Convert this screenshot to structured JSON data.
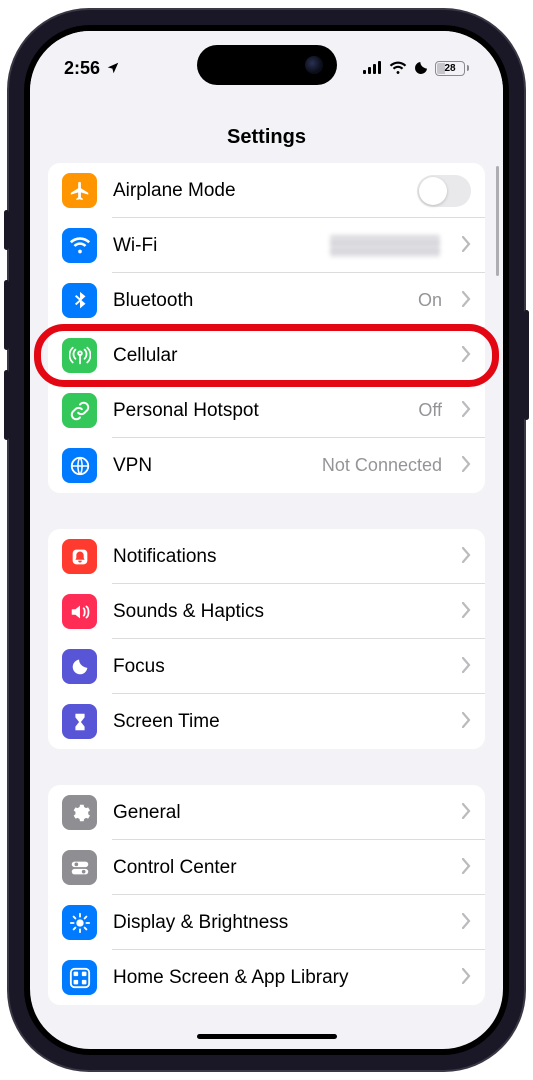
{
  "status": {
    "time": "2:56",
    "battery_percent": "28"
  },
  "header": {
    "title": "Settings"
  },
  "groups": [
    {
      "items": [
        {
          "label": "Airplane Mode",
          "value": "",
          "type": "toggle",
          "toggled": false,
          "icon": "airplane",
          "color": "c-orange"
        },
        {
          "label": "Wi-Fi",
          "value": "",
          "type": "link-redacted",
          "icon": "wifi",
          "color": "c-blue"
        },
        {
          "label": "Bluetooth",
          "value": "On",
          "type": "link",
          "icon": "bluetooth",
          "color": "c-blue"
        },
        {
          "label": "Cellular",
          "value": "",
          "type": "link",
          "icon": "antenna",
          "color": "c-green",
          "highlighted": true
        },
        {
          "label": "Personal Hotspot",
          "value": "Off",
          "type": "link",
          "icon": "link",
          "color": "c-green2"
        },
        {
          "label": "VPN",
          "value": "Not Connected",
          "type": "link",
          "icon": "globe",
          "color": "c-blue"
        }
      ]
    },
    {
      "items": [
        {
          "label": "Notifications",
          "value": "",
          "type": "link",
          "icon": "bell",
          "color": "c-red"
        },
        {
          "label": "Sounds & Haptics",
          "value": "",
          "type": "link",
          "icon": "speaker",
          "color": "c-pink"
        },
        {
          "label": "Focus",
          "value": "",
          "type": "link",
          "icon": "moon",
          "color": "c-indigo"
        },
        {
          "label": "Screen Time",
          "value": "",
          "type": "link",
          "icon": "hourglass",
          "color": "c-indigo"
        }
      ]
    },
    {
      "items": [
        {
          "label": "General",
          "value": "",
          "type": "link",
          "icon": "gear",
          "color": "c-gray"
        },
        {
          "label": "Control Center",
          "value": "",
          "type": "link",
          "icon": "switches",
          "color": "c-gray"
        },
        {
          "label": "Display & Brightness",
          "value": "",
          "type": "link",
          "icon": "sun",
          "color": "c-blue"
        },
        {
          "label": "Home Screen & App Library",
          "value": "",
          "type": "link",
          "icon": "grid",
          "color": "c-blue"
        }
      ]
    }
  ]
}
